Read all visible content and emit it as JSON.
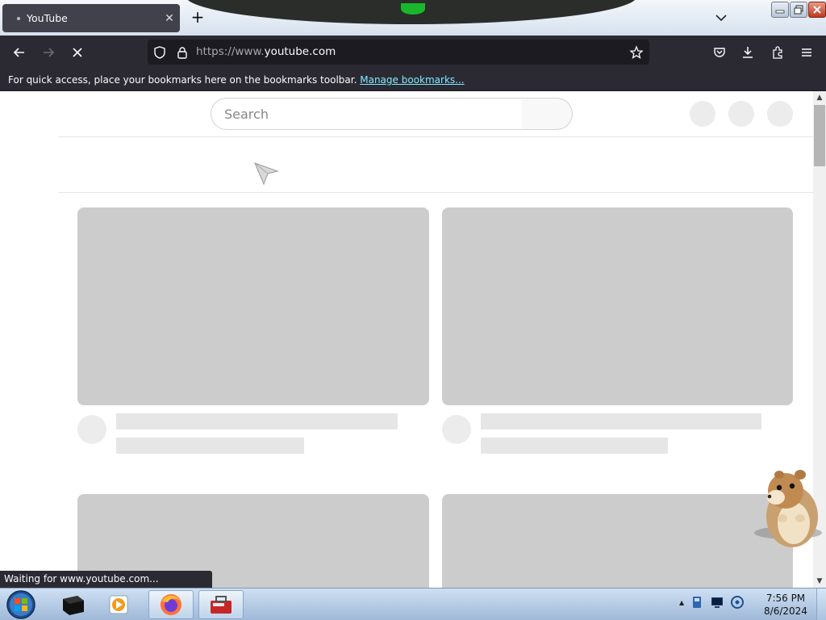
{
  "browser": {
    "tab": {
      "title": "YouTube"
    },
    "new_tab_symbol": "+",
    "close_tab_symbol": "✕",
    "url": {
      "prefix": "https://www.",
      "domain": "youtube.com"
    },
    "bookmarks_bar": {
      "message": "For quick access, place your bookmarks here on the bookmarks toolbar.",
      "link": "Manage bookmarks..."
    },
    "status": "Waiting for www.youtube.com...",
    "icons": [
      "back-icon",
      "forward-icon",
      "stop-icon",
      "shield-icon",
      "lock-icon",
      "star-icon",
      "pocket-icon",
      "download-icon",
      "extensions-icon",
      "menu-icon"
    ],
    "accent": "#80ebff",
    "toolbar_color": "#2b2a33"
  },
  "youtube": {
    "search_placeholder": "Search"
  },
  "taskbar": {
    "time": "7:56 PM",
    "date": "8/6/2024",
    "tray_expand": "▲"
  },
  "scrollbar": {
    "up": "▲",
    "down": "▼"
  }
}
